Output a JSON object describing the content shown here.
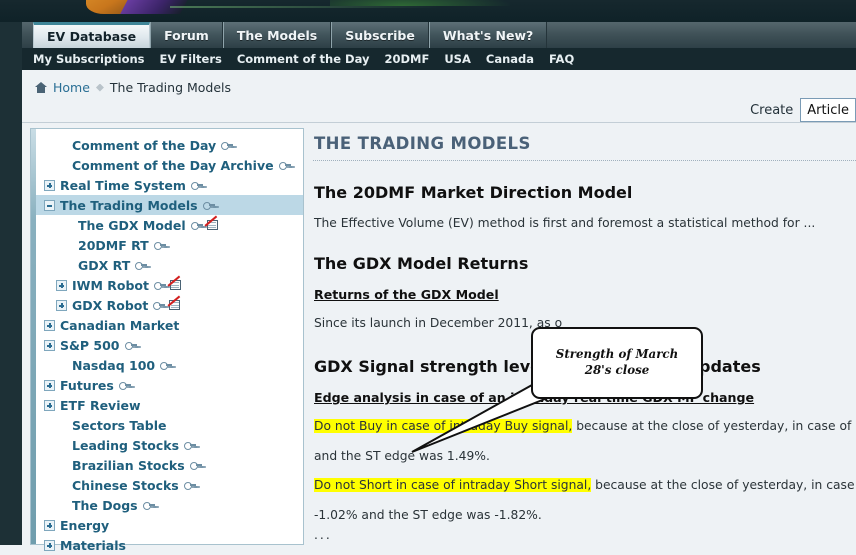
{
  "masthead": {
    "alt": "site-banner-artwork"
  },
  "tabs": [
    {
      "label": "EV Database",
      "active": true
    },
    {
      "label": "Forum",
      "active": false
    },
    {
      "label": "The Models",
      "active": false
    },
    {
      "label": "Subscribe",
      "active": false
    },
    {
      "label": "What's New?",
      "active": false
    }
  ],
  "subnav": [
    "My Subscriptions",
    "EV Filters",
    "Comment of the Day",
    "20DMF",
    "USA",
    "Canada",
    "FAQ"
  ],
  "breadcrumb": {
    "home_label": "Home",
    "current": "The Trading Models",
    "home_icon": "home-icon",
    "separator_icon": "diamond-separator-icon"
  },
  "create": {
    "label": "Create",
    "selected_option": "Article",
    "options": [
      "Article"
    ]
  },
  "sidebar": {
    "items": [
      {
        "label": "Comment of the Day",
        "toggle": "none",
        "indent": 1,
        "key": true,
        "book": false,
        "selected": false
      },
      {
        "label": "Comment of the Day Archive",
        "toggle": "none",
        "indent": 1,
        "key": true,
        "book": false,
        "selected": false
      },
      {
        "label": "Real Time System",
        "toggle": "plus",
        "indent": 0,
        "key": true,
        "book": false,
        "selected": false
      },
      {
        "label": "The Trading Models",
        "toggle": "minus",
        "indent": 0,
        "key": true,
        "book": false,
        "selected": true
      },
      {
        "label": "The GDX Model",
        "toggle": "none",
        "indent": 2,
        "key": true,
        "book": true,
        "selected": false
      },
      {
        "label": "20DMF RT",
        "toggle": "none",
        "indent": 2,
        "key": true,
        "book": false,
        "selected": false
      },
      {
        "label": "GDX RT",
        "toggle": "none",
        "indent": 2,
        "key": true,
        "book": false,
        "selected": false
      },
      {
        "label": "IWM Robot",
        "toggle": "plus",
        "indent": 1,
        "key": true,
        "book": true,
        "selected": false
      },
      {
        "label": "GDX Robot",
        "toggle": "plus",
        "indent": 1,
        "key": true,
        "book": true,
        "selected": false
      },
      {
        "label": "Canadian Market",
        "toggle": "plus",
        "indent": 0,
        "key": false,
        "book": false,
        "selected": false
      },
      {
        "label": "S&P 500",
        "toggle": "plus",
        "indent": 0,
        "key": true,
        "book": false,
        "selected": false
      },
      {
        "label": "Nasdaq 100",
        "toggle": "none",
        "indent": 1,
        "key": true,
        "book": false,
        "selected": false
      },
      {
        "label": "Futures",
        "toggle": "plus",
        "indent": 0,
        "key": true,
        "book": false,
        "selected": false
      },
      {
        "label": "ETF Review",
        "toggle": "plus",
        "indent": 0,
        "key": false,
        "book": false,
        "selected": false
      },
      {
        "label": "Sectors Table",
        "toggle": "none",
        "indent": 1,
        "key": false,
        "book": false,
        "selected": false
      },
      {
        "label": "Leading Stocks",
        "toggle": "none",
        "indent": 1,
        "key": true,
        "book": false,
        "selected": false
      },
      {
        "label": "Brazilian Stocks",
        "toggle": "none",
        "indent": 1,
        "key": true,
        "book": false,
        "selected": false
      },
      {
        "label": "Chinese Stocks",
        "toggle": "none",
        "indent": 1,
        "key": true,
        "book": false,
        "selected": false
      },
      {
        "label": "The Dogs",
        "toggle": "none",
        "indent": 1,
        "key": true,
        "book": false,
        "selected": false
      },
      {
        "label": "Energy",
        "toggle": "plus",
        "indent": 0,
        "key": false,
        "book": false,
        "selected": false
      },
      {
        "label": "Materials",
        "toggle": "plus",
        "indent": 0,
        "key": false,
        "book": false,
        "selected": false
      }
    ]
  },
  "content": {
    "page_title": "THE TRADING MODELS",
    "section_20dmf": {
      "heading": "The 20DMF Market Direction Model",
      "paragraph": "The Effective Volume (EV) method is first and foremost a statistical method for ..."
    },
    "section_gdx_returns": {
      "heading": "The GDX Model Returns",
      "link": "Returns of the GDX Model",
      "paragraph": "Since its launch in December 2011, as o"
    },
    "section_signal": {
      "heading": "GDX Signal strength levels and real time updates",
      "subhead": "Edge analysis in case of an intraday real time GDX MF change",
      "line1_highlight": "Do not Buy in case of intraday Buy signal,",
      "line1_rest": " because at the close of yesterday, in case of a Buy signal",
      "line2": "and the ST edge was 1.49%.",
      "line3_highlight": "Do not Short in case of intraday Short signal,",
      "line3_rest": " because at the close of yesterday, in case of a Short",
      "line4": "-1.02% and the ST edge was -1.82%.",
      "ellipsis": "..."
    }
  },
  "callout": {
    "text": "Strength of March 28's close"
  },
  "colors": {
    "masthead_bg": "#16282e",
    "tabstrip_bg": "#3f5157",
    "subnav_bg": "#16282e",
    "page_bg": "#eef2f5",
    "sidebar_link": "#1f5f7d",
    "sidebar_selected_bg": "#bcd8e6",
    "page_title": "#4a6178",
    "link_blue": "#2a6f95",
    "highlight_yellow": "#ffff00",
    "active_tab_accent": "#3f8698"
  }
}
